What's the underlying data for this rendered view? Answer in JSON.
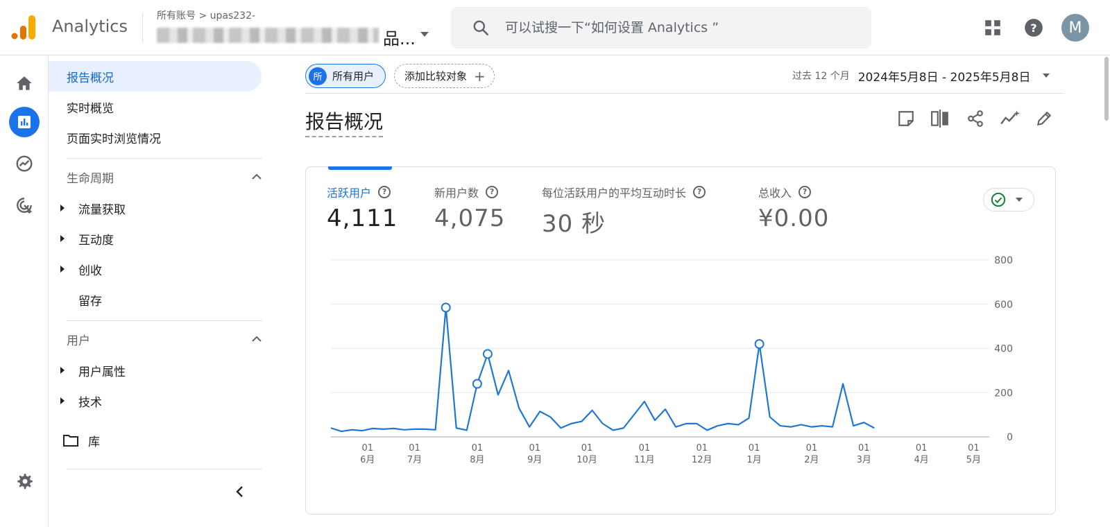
{
  "topbar": {
    "app_title": "Analytics",
    "breadcrumb": "所有账号 > upas232-",
    "account_visible_suffix": "品...",
    "search_placeholder": "可以试搜一下“如何设置 Analytics ”",
    "avatar_letter": "M"
  },
  "nav": {
    "items": [
      {
        "label": "报告概况",
        "active": true
      },
      {
        "label": "实时概览",
        "active": false
      },
      {
        "label": "页面实时浏览情况",
        "active": false
      }
    ],
    "lifecycle": {
      "header": "生命周期",
      "items": [
        "流量获取",
        "互动度",
        "创收",
        "留存"
      ]
    },
    "users": {
      "header": "用户",
      "items": [
        "用户属性",
        "技术"
      ]
    },
    "library": "库"
  },
  "filters": {
    "segment_icon": "所",
    "segment": "所有用户",
    "add_comparison": "添加比较对象",
    "date_label": "过去 12 个月",
    "date_range": "2024年5月8日 - 2025年5月8日"
  },
  "page_title": "报告概况",
  "metrics": [
    {
      "label": "活跃用户",
      "value": "4,111",
      "selected": true
    },
    {
      "label": "新用户数",
      "value": "4,075",
      "selected": false
    },
    {
      "label": "每位活跃用户的平均互动时长",
      "value": "30 秒",
      "selected": false
    },
    {
      "label": "总收入",
      "value": "¥0.00",
      "selected": false
    }
  ],
  "colors": {
    "accent": "#1a73e8",
    "line": "#1f77d4",
    "success": "#188038"
  },
  "chart_data": {
    "type": "line",
    "series": [
      {
        "values": [
          40,
          25,
          32,
          28,
          38,
          35,
          38,
          32,
          35,
          35,
          32,
          585,
          40,
          30,
          240,
          375,
          190,
          300,
          130,
          45,
          115,
          90,
          40,
          60,
          70,
          120,
          60,
          30,
          40,
          100,
          160,
          75,
          125,
          45,
          60,
          60,
          30,
          50,
          60,
          55,
          85,
          420,
          90,
          50,
          45,
          55,
          45,
          50,
          45,
          240,
          50,
          65,
          40
        ],
        "highlighted_indices": [
          11,
          14,
          15,
          41
        ]
      }
    ],
    "x_ticks": [
      {
        "day": "01",
        "month": "6月"
      },
      {
        "day": "01",
        "month": "7月"
      },
      {
        "day": "01",
        "month": "8月"
      },
      {
        "day": "01",
        "month": "9月"
      },
      {
        "day": "01",
        "month": "10月"
      },
      {
        "day": "01",
        "month": "11月"
      },
      {
        "day": "01",
        "month": "12月"
      },
      {
        "day": "01",
        "month": "1月"
      },
      {
        "day": "01",
        "month": "2月"
      },
      {
        "day": "01",
        "month": "3月"
      },
      {
        "day": "01",
        "month": "4月"
      },
      {
        "day": "01",
        "month": "5月"
      }
    ],
    "x_tick_positions": [
      3.5,
      8,
      14,
      19.5,
      24.5,
      30,
      35.5,
      40.5,
      46,
      51,
      56.5,
      61.5
    ],
    "x_range": [
      0,
      63
    ],
    "y_ticks": [
      0,
      200,
      400,
      600,
      800
    ],
    "ylim": [
      0,
      800
    ],
    "grid": true,
    "y_axis_side": "right"
  }
}
